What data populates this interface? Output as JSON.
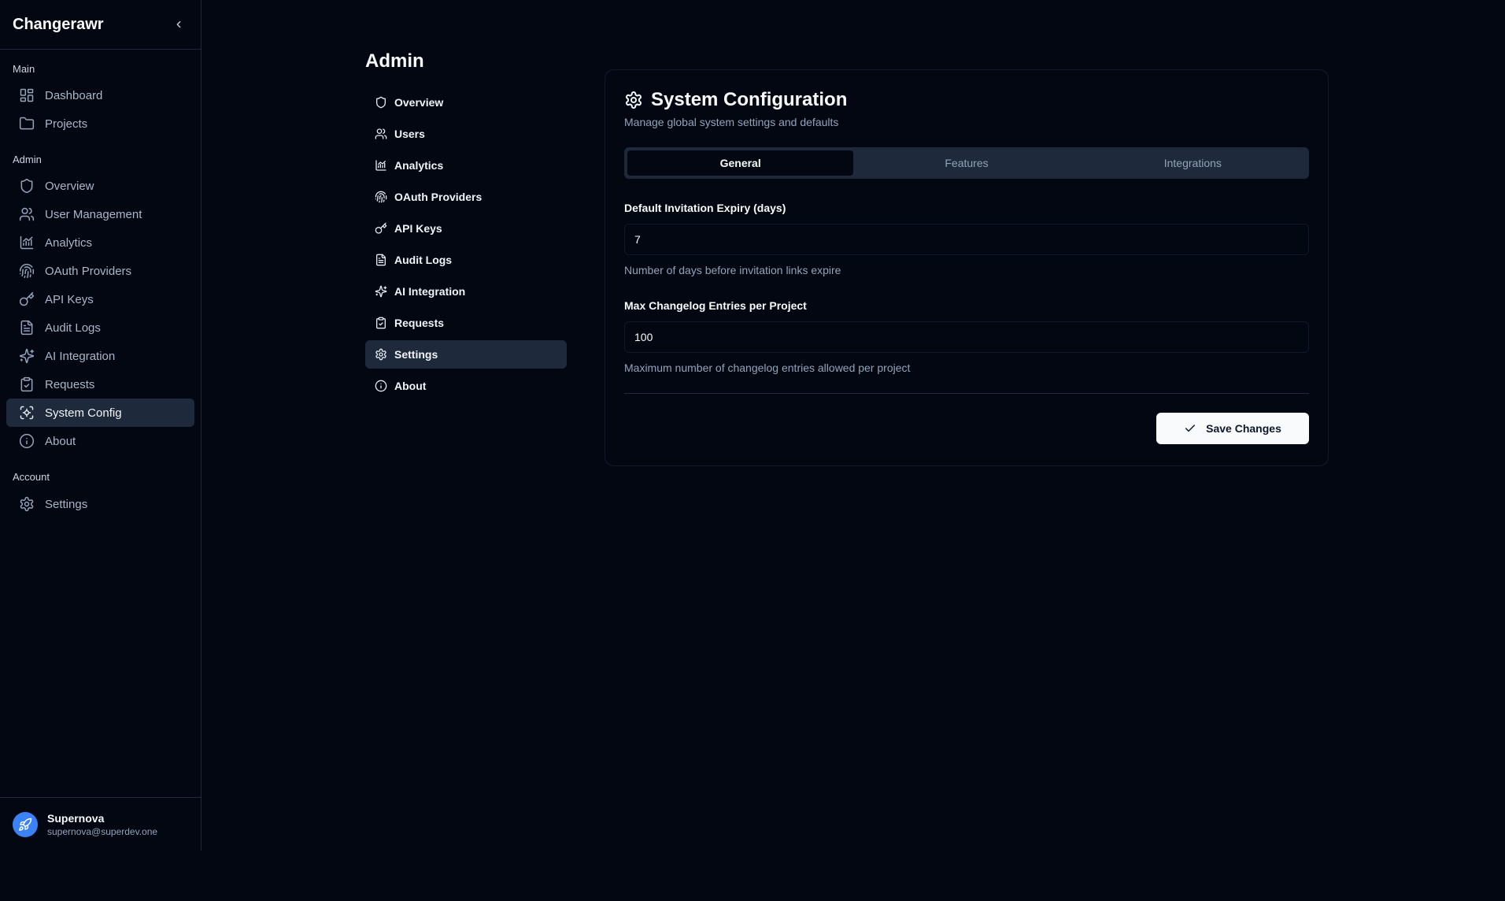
{
  "app": {
    "name": "Changerawr"
  },
  "sidebar": {
    "sections": [
      {
        "label": "Main"
      },
      {
        "label": "Admin"
      },
      {
        "label": "Account"
      }
    ],
    "main_items": [
      {
        "label": "Dashboard",
        "icon": "grid-icon"
      },
      {
        "label": "Projects",
        "icon": "folder-icon"
      }
    ],
    "admin_items": [
      {
        "label": "Overview",
        "icon": "shield-icon"
      },
      {
        "label": "User Management",
        "icon": "users-icon"
      },
      {
        "label": "Analytics",
        "icon": "chart-icon"
      },
      {
        "label": "OAuth Providers",
        "icon": "fingerprint-icon"
      },
      {
        "label": "API Keys",
        "icon": "key-icon"
      },
      {
        "label": "Audit Logs",
        "icon": "file-icon"
      },
      {
        "label": "AI Integration",
        "icon": "sparkles-icon"
      },
      {
        "label": "Requests",
        "icon": "clipboard-icon"
      },
      {
        "label": "System Config",
        "icon": "system-config-icon",
        "active": true
      },
      {
        "label": "About",
        "icon": "info-icon"
      }
    ],
    "account_items": [
      {
        "label": "Settings",
        "icon": "gear-icon"
      }
    ],
    "user": {
      "name": "Supernova",
      "email": "supernova@superdev.one"
    }
  },
  "admin": {
    "title": "Admin",
    "nav": [
      {
        "label": "Overview",
        "icon": "shield-icon"
      },
      {
        "label": "Users",
        "icon": "users-icon"
      },
      {
        "label": "Analytics",
        "icon": "chart-icon"
      },
      {
        "label": "OAuth Providers",
        "icon": "fingerprint-icon"
      },
      {
        "label": "API Keys",
        "icon": "key-icon"
      },
      {
        "label": "Audit Logs",
        "icon": "file-icon"
      },
      {
        "label": "AI Integration",
        "icon": "sparkles-icon"
      },
      {
        "label": "Requests",
        "icon": "clipboard-icon"
      },
      {
        "label": "Settings",
        "icon": "gear-icon",
        "active": true
      },
      {
        "label": "About",
        "icon": "info-icon"
      }
    ]
  },
  "card": {
    "title": "System Configuration",
    "description": "Manage global system settings and defaults",
    "tabs": [
      {
        "label": "General",
        "active": true
      },
      {
        "label": "Features"
      },
      {
        "label": "Integrations"
      }
    ],
    "fields": [
      {
        "label": "Default Invitation Expiry (days)",
        "value": "7",
        "help": "Number of days before invitation links expire"
      },
      {
        "label": "Max Changelog Entries per Project",
        "value": "100",
        "help": "Maximum number of changelog entries allowed per project"
      }
    ],
    "save_label": "Save Changes"
  },
  "colors": {
    "background": "#030712",
    "surface_active": "#1e293b",
    "text_primary": "#f8fafc",
    "text_muted": "#94a3b8",
    "button_bg": "#f8fafc",
    "avatar_bg": "#3b82f6"
  }
}
